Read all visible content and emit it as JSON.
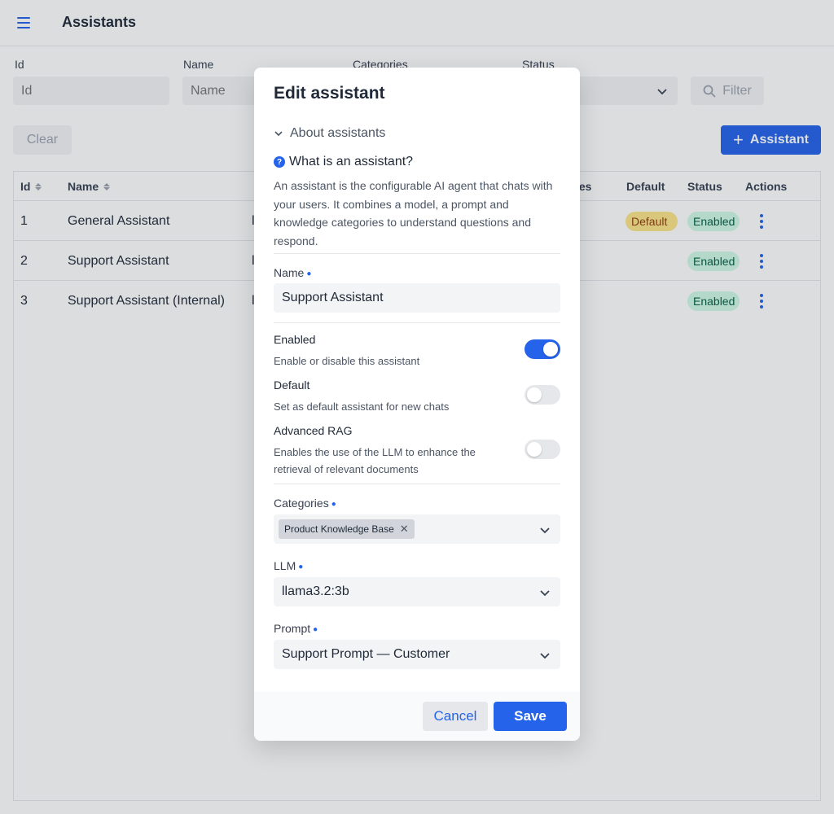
{
  "header": {
    "title": "Assistants"
  },
  "filters": {
    "id": {
      "label": "Id",
      "placeholder": "Id"
    },
    "name": {
      "label": "Name",
      "placeholder": "Name"
    },
    "categories": {
      "label": "Categories"
    },
    "status": {
      "label": "Status"
    },
    "filter_label": "Filter",
    "clear_label": "Clear",
    "add_label": "Assistant"
  },
  "table": {
    "columns": {
      "id": "Id",
      "name": "Name",
      "categories_partial": "ies",
      "default": "Default",
      "status": "Status",
      "actions": "Actions"
    },
    "rows": [
      {
        "id": "1",
        "name": "General Assistant",
        "col3": "l",
        "default_badge": "Default",
        "status": "Enabled"
      },
      {
        "id": "2",
        "name": "Support Assistant",
        "col3": "l",
        "default_badge": "",
        "status": "Enabled"
      },
      {
        "id": "3",
        "name": "Support Assistant (Internal)",
        "col3": "l",
        "default_badge": "",
        "status": "Enabled"
      }
    ]
  },
  "modal": {
    "title": "Edit assistant",
    "about_toggle": "About assistants",
    "about_title": "What is an assistant?",
    "about_text": "An assistant is the configurable AI agent that chats with your users. It combines a model, a prompt and knowledge categories to understand questions and respond.",
    "name_label": "Name",
    "name_value": "Support Assistant",
    "enabled": {
      "label": "Enabled",
      "description": "Enable or disable this assistant",
      "value": true
    },
    "default": {
      "label": "Default",
      "description": "Set as default assistant for new chats",
      "value": false
    },
    "advanced_rag": {
      "label": "Advanced RAG",
      "description": "Enables the use of the LLM to enhance the retrieval of relevant documents",
      "value": false
    },
    "categories_label": "Categories",
    "categories_selected": [
      "Product Knowledge Base"
    ],
    "llm_label": "LLM",
    "llm_value": "llama3.2:3b",
    "prompt_label": "Prompt",
    "prompt_value": "Support Prompt — Customer",
    "cancel_label": "Cancel",
    "save_label": "Save"
  },
  "colors": {
    "accent": "#2563eb",
    "enabled_badge": "#d1fae5",
    "default_badge": "#fde68a"
  }
}
